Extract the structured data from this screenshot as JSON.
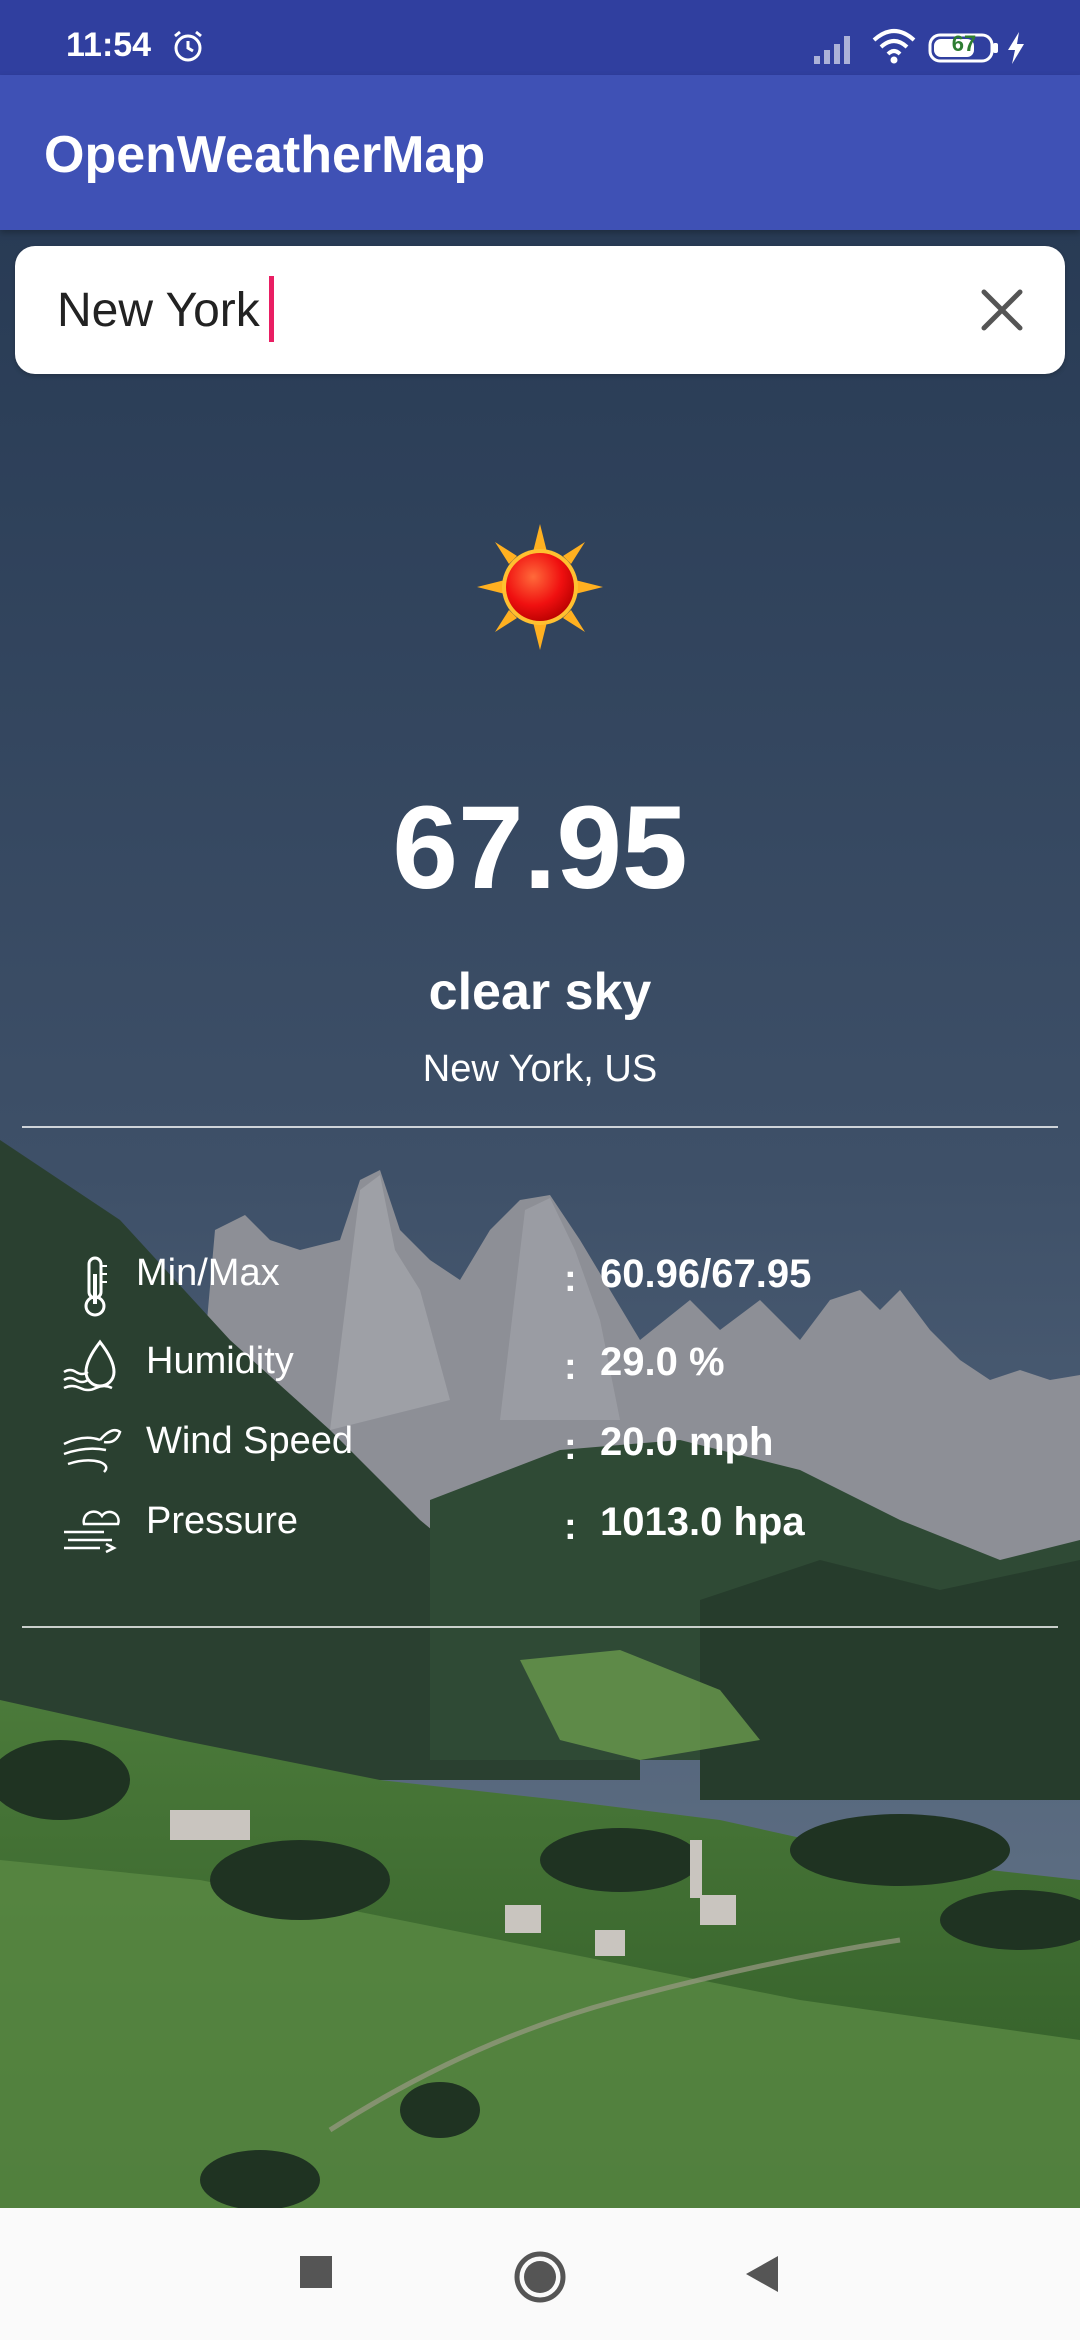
{
  "status_bar": {
    "time": "11:54",
    "battery": "67",
    "icons": [
      "alarm-icon",
      "signal-icon",
      "wifi-icon",
      "battery-icon",
      "charging-icon"
    ]
  },
  "app_bar": {
    "title": "OpenWeatherMap",
    "color": "#3f51b5"
  },
  "search": {
    "value": "New York",
    "placeholder": "",
    "clear_icon": "close-icon"
  },
  "weather": {
    "icon": "sun-icon",
    "temperature": "67.95",
    "description": "clear sky",
    "location": "New York, US"
  },
  "details": [
    {
      "icon": "thermometer-icon",
      "label": "Min/Max",
      "colon": ":",
      "value": "60.96/67.95"
    },
    {
      "icon": "humidity-icon",
      "label": "Humidity",
      "colon": ":",
      "value": "29.0 %"
    },
    {
      "icon": "wind-icon",
      "label": "Wind Speed",
      "colon": ":",
      "value": "20.0 mph"
    },
    {
      "icon": "pressure-icon",
      "label": "Pressure",
      "colon": ":",
      "value": "1013.0 hpa"
    }
  ],
  "nav_bar": {
    "icons": [
      "recent-apps-icon",
      "home-icon",
      "back-icon"
    ]
  }
}
